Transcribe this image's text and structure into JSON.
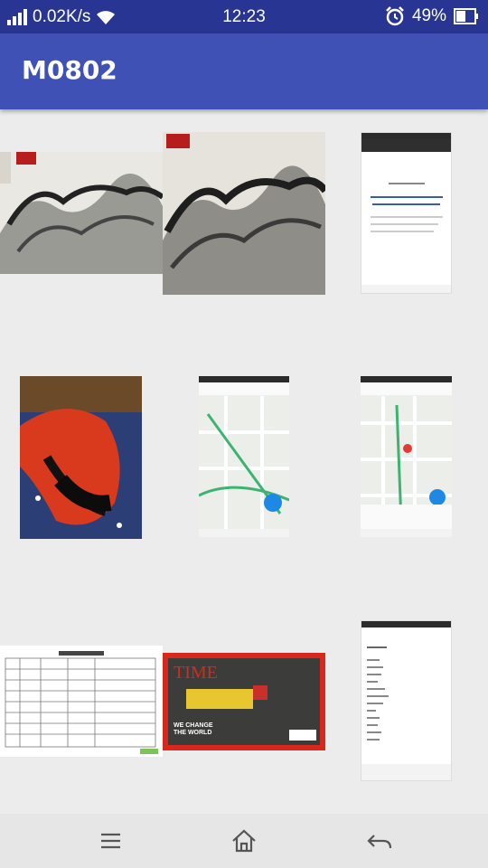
{
  "status_bar": {
    "net_speed": "0.02K/s",
    "time": "12:23",
    "battery": "49%",
    "icons": [
      "signal-icon",
      "wifi-icon",
      "alarm-icon",
      "battery-icon"
    ]
  },
  "app_bar": {
    "title": "M0802"
  },
  "gallery": {
    "images": [
      {
        "name": "ink-painting-1",
        "kind": "photo"
      },
      {
        "name": "ink-painting-2",
        "kind": "photo"
      },
      {
        "name": "phone-screenshot-doc",
        "kind": "screenshot"
      },
      {
        "name": "lobster-plush-photo",
        "kind": "photo"
      },
      {
        "name": "map-screenshot-1",
        "kind": "screenshot"
      },
      {
        "name": "map-screenshot-2",
        "kind": "screenshot"
      },
      {
        "name": "table-document",
        "kind": "document"
      },
      {
        "name": "time-magazine-cover",
        "kind": "photo"
      },
      {
        "name": "phone-screenshot-list",
        "kind": "screenshot"
      }
    ]
  },
  "nav_bar": {
    "icons": [
      "menu-icon",
      "home-icon",
      "back-icon"
    ]
  },
  "colors": {
    "status_bar": "#283593",
    "app_bar": "#3f51b5",
    "background": "#ececec",
    "nav_bar": "#e6e6e6"
  }
}
